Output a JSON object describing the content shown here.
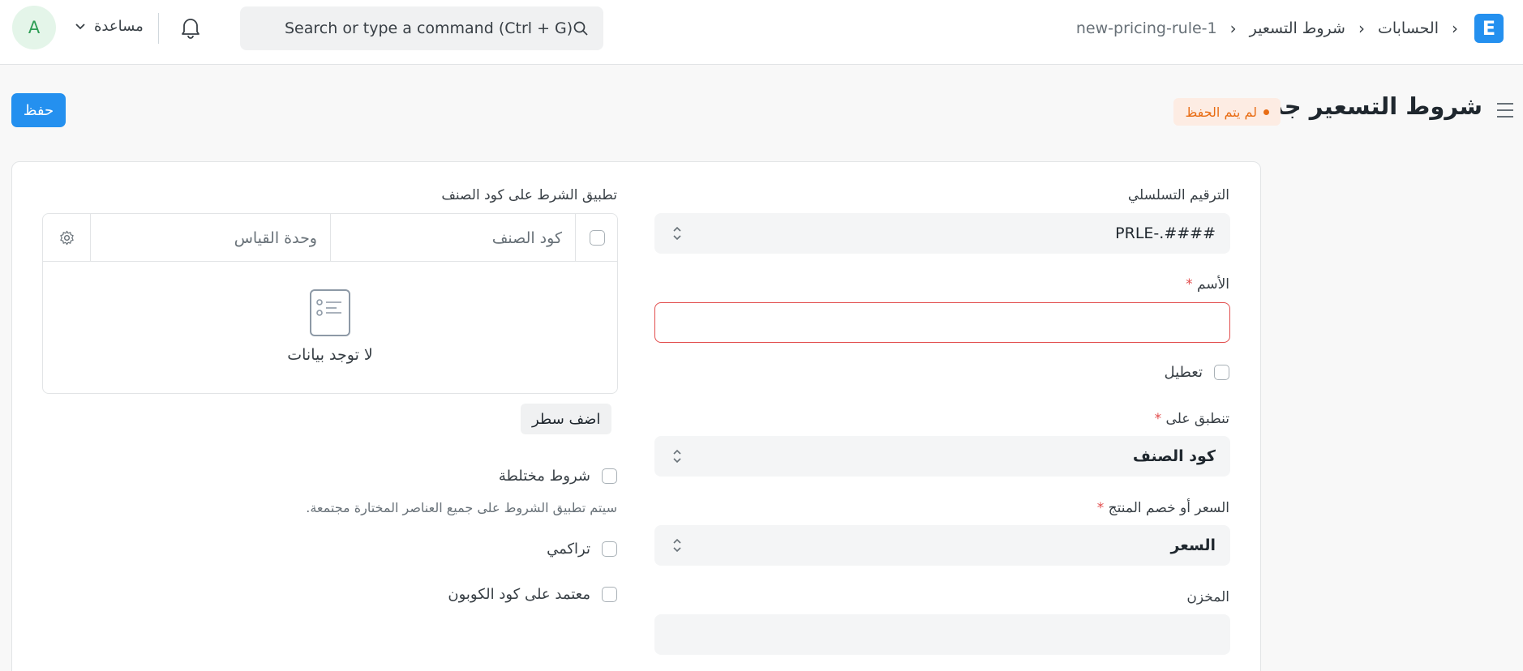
{
  "navbar": {
    "logo_letter": "E",
    "breadcrumbs": [
      "الحسابات",
      "شروط التسعير",
      "new-pricing-rule-1"
    ],
    "search_placeholder": "Search or type a command (Ctrl + G)",
    "help_label": "مساعدة",
    "avatar_letter": "A"
  },
  "page": {
    "title": "شروط التسعير جديد",
    "status": "لم يتم الحفظ",
    "save_label": "حفظ"
  },
  "form": {
    "naming_series": {
      "label": "الترقيم التسلسلي",
      "value": "PRLE-.####"
    },
    "title": {
      "label": "الأسم",
      "value": ""
    },
    "disable": {
      "label": "تعطيل",
      "checked": false
    },
    "apply_on": {
      "label": "تنطبق على",
      "value": "كود الصنف"
    },
    "price_or_discount": {
      "label": "السعر أو خصم المنتج",
      "value": "السعر"
    },
    "warehouse": {
      "label": "المخزن",
      "value": ""
    },
    "items_table": {
      "label": "تطبيق الشرط على كود الصنف",
      "columns": [
        "كود الصنف",
        "وحدة القياس"
      ],
      "empty_text": "لا توجد بيانات",
      "add_row_label": "اضف سطر"
    },
    "mixed_conditions": {
      "label": "شروط مختلطة",
      "description": "سيتم تطبيق الشروط على جميع العناصر المختارة مجتمعة."
    },
    "cumulative": {
      "label": "تراكمي"
    },
    "coupon_based": {
      "label": "معتمد على كود الكوبون"
    }
  },
  "colors": {
    "primary": "#2490ef",
    "warning": "#e86c13",
    "error": "#e24c4c",
    "avatar": "#2e9e55"
  }
}
